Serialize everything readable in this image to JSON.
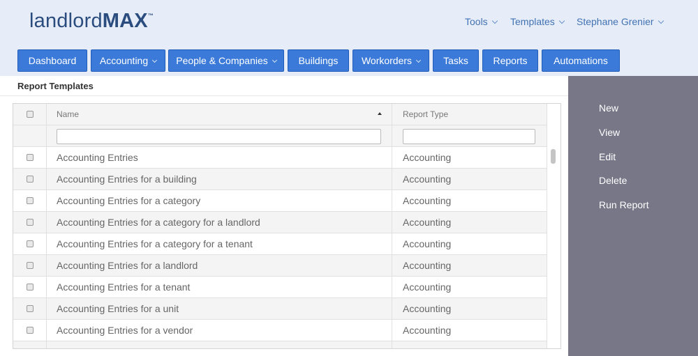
{
  "brand": {
    "light": "landlord",
    "bold": "MAX",
    "tm": "™"
  },
  "topnav": {
    "tools": "Tools",
    "templates": "Templates",
    "user": "Stephane Grenier"
  },
  "mainnav": {
    "dashboard": "Dashboard",
    "accounting": "Accounting",
    "people": "People & Companies",
    "buildings": "Buildings",
    "workorders": "Workorders",
    "tasks": "Tasks",
    "reports": "Reports",
    "automations": "Automations"
  },
  "panel": {
    "title": "Report Templates"
  },
  "table": {
    "columns": {
      "name": "Name",
      "type": "Report Type"
    },
    "filters": {
      "name": "",
      "type": ""
    },
    "rows": [
      {
        "name": "Accounting Entries",
        "type": "Accounting"
      },
      {
        "name": "Accounting Entries for a building",
        "type": "Accounting"
      },
      {
        "name": "Accounting Entries for a category",
        "type": "Accounting"
      },
      {
        "name": "Accounting Entries for a category for a landlord",
        "type": "Accounting"
      },
      {
        "name": "Accounting Entries for a category for a tenant",
        "type": "Accounting"
      },
      {
        "name": "Accounting Entries for a landlord",
        "type": "Accounting"
      },
      {
        "name": "Accounting Entries for a tenant",
        "type": "Accounting"
      },
      {
        "name": "Accounting Entries for a unit",
        "type": "Accounting"
      },
      {
        "name": "Accounting Entries for a vendor",
        "type": "Accounting"
      },
      {
        "name": "",
        "type": ""
      }
    ]
  },
  "sidebar": {
    "new": "New",
    "view": "View",
    "edit": "Edit",
    "delete": "Delete",
    "run": "Run Report"
  },
  "colors": {
    "header_bg": "#e6edf8",
    "nav_button": "#3b7ad8",
    "top_link": "#4272b4",
    "sidebar_bg": "#777788",
    "logo": "#2b4c7e"
  },
  "icons": [
    "chevron-down-icon",
    "sort-ascending-icon",
    "checkbox-icon"
  ]
}
